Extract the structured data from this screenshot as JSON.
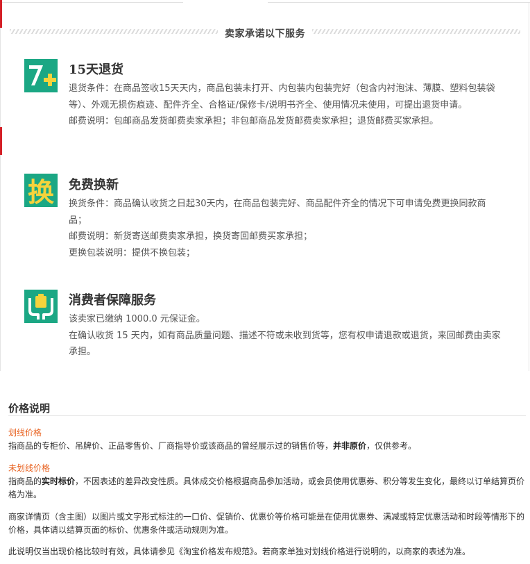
{
  "promise": {
    "heading": "卖家承诺以下服务",
    "services": [
      {
        "icon": "return-15-days-icon",
        "title": "15天退货",
        "lines": [
          "退货条件：在商品签收15天天内，商品包装未打开、内包装内包装完好（包含内衬泡沫、薄膜、塑料包装袋等）、外观无损伤痕迹、配件齐全、合格证/保修卡/说明书齐全、使用情况未使用，可提出退货申请。",
          "邮费说明：包邮商品发货邮费卖家承担；非包邮商品发货邮费卖家承担；退货邮费买家承担。"
        ]
      },
      {
        "icon": "exchange-icon",
        "icon_text": "换",
        "title": "免费换新",
        "lines": [
          "换货条件：商品确认收货之日起30天内，在商品包装完好、商品配件齐全的情况下可申请免费更换同款商品；",
          "邮费说明：新货寄送邮费卖家承担，换货寄回邮费买家承担；",
          "更换包装说明：提供不换包装；"
        ]
      },
      {
        "icon": "consumer-protection-icon",
        "title": "消费者保障服务",
        "lines": [
          "该卖家已缴纳 1000.0 元保证金。",
          "在确认收货 15 天内，如有商品质量问题、描述不符或未收到货等，您有权申请退款或退货，来回邮费由卖家承担。"
        ]
      }
    ]
  },
  "price": {
    "title": "价格说明",
    "struck_label": "划线价格",
    "struck_pre": "指商品的专柜价、吊牌价、正品零售价、厂商指导价或该商品的曾经展示过的销售价等，",
    "struck_bold": "并非原价",
    "struck_post": "，仅供参考。",
    "unstruck_label": "未划线价格",
    "unstruck_pre": "指商品的",
    "unstruck_bold": "实时标价",
    "unstruck_post": "，不因表述的差异改变性质。具体成交价格根据商品参加活动，或会员使用优惠券、积分等发生变化，最终以订单结算页价格为准。",
    "detail_note": "商家详情页（含主图）以图片或文字形式标注的一口价、促销价、优惠价等价格可能是在使用优惠券、满减或特定优惠活动和时段等情形下的价格，具体请以结算页面的标价、优惠条件或活动规则为准。",
    "footnote": "此说明仅当出现价格比较时有效，具体请参见《淘宝价格发布规范》。若商家单独对划线价格进行说明的，以商家的表述为准。"
  },
  "colors": {
    "icon_bg": "#1ba784",
    "icon_accent": "#f5d33c",
    "label_orange": "#e8611f",
    "left_mark_red": "#d42027"
  }
}
